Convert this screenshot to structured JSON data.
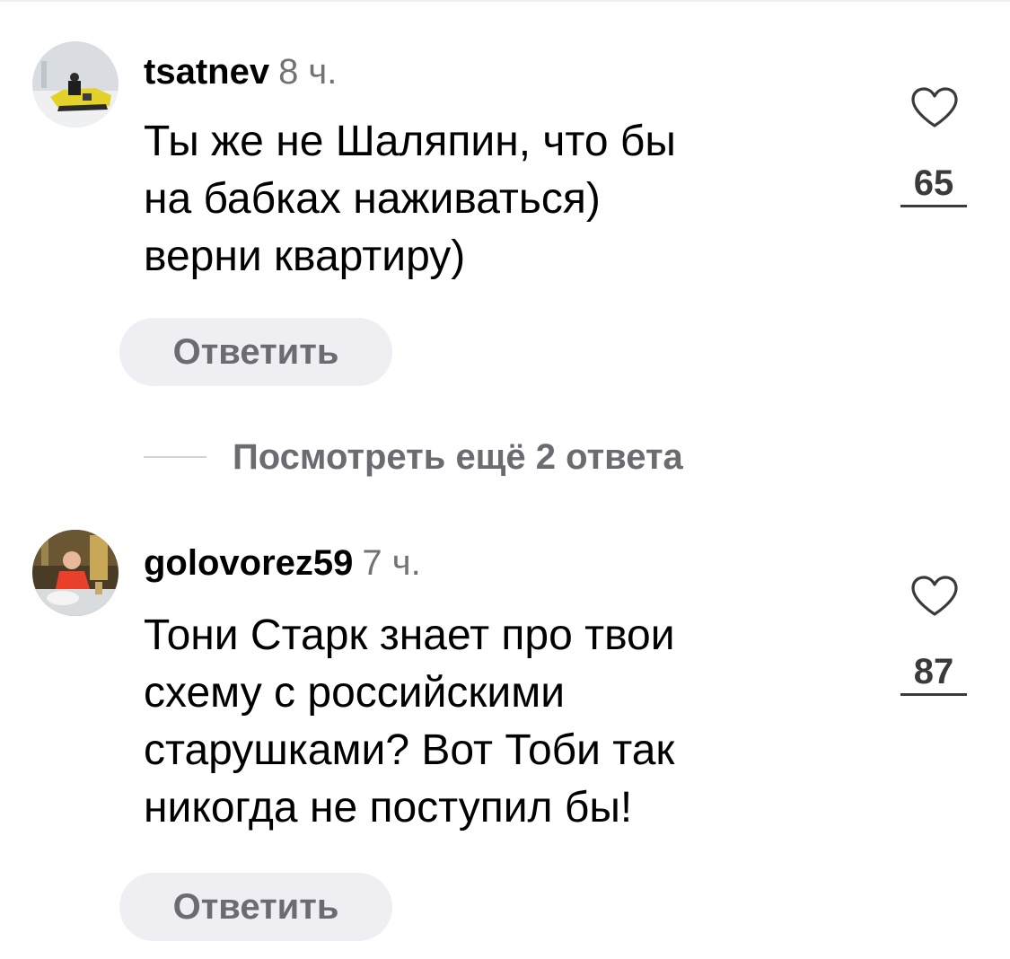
{
  "comments": [
    {
      "username": "tsatnev",
      "time": "8 ч.",
      "text_lines": [
        "Ты же не Шаляпин, что бы",
        "на бабках наживаться)",
        "верни квартиру)"
      ],
      "reply_label": "Ответить",
      "likes": "65",
      "like_icon": "heart-outline-icon",
      "avatar_desc": "snowmobile-photo"
    },
    {
      "username": "golovorez59",
      "time": "7 ч.",
      "text_lines": [
        "Тони Старк знает про твои",
        "схему с российскими",
        "старушками? Вот Тоби так",
        "никогда не поступил бы!"
      ],
      "reply_label": "Ответить",
      "likes": "87",
      "like_icon": "heart-outline-icon",
      "avatar_desc": "person-at-table-photo"
    }
  ],
  "more_replies": {
    "label": "Посмотреть ещё 2 ответа"
  },
  "colors": {
    "text": "#000000",
    "secondary": "#737373",
    "button_bg": "#efeff3",
    "button_text": "#6b6b72"
  }
}
